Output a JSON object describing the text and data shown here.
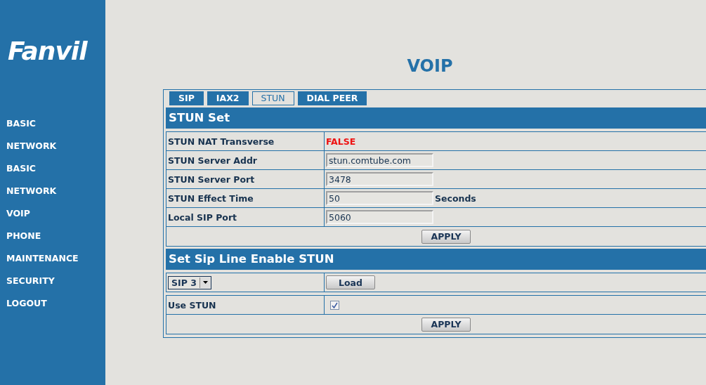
{
  "logo": "Fanvil",
  "nav": [
    "BASIC",
    "NETWORK",
    "BASIC",
    "NETWORK",
    "VOIP",
    "PHONE",
    "MAINTENANCE",
    "SECURITY",
    "LOGOUT"
  ],
  "title": "VOIP",
  "tabs": [
    {
      "label": "SIP",
      "selected": false
    },
    {
      "label": "IAX2",
      "selected": false
    },
    {
      "label": "STUN",
      "selected": true
    },
    {
      "label": "DIAL PEER",
      "selected": false
    }
  ],
  "stun_set": {
    "heading": "STUN Set",
    "rows": [
      {
        "kind": "status",
        "label": "STUN NAT Transverse",
        "value": "FALSE"
      },
      {
        "kind": "field",
        "label": "STUN Server Addr",
        "value": "stun.comtube.com"
      },
      {
        "kind": "field",
        "label": "STUN Server Port",
        "value": "3478"
      },
      {
        "kind": "field",
        "label": "STUN Effect Time",
        "value": "50",
        "unit": "Seconds"
      },
      {
        "kind": "field",
        "label": "Local SIP Port",
        "value": "5060"
      }
    ],
    "apply": "APPLY"
  },
  "sip_line": {
    "heading": "Set Sip Line Enable STUN",
    "line": "SIP 3",
    "load": "Load",
    "use_stun": {
      "label": "Use STUN",
      "checked": true
    },
    "apply": "APPLY"
  }
}
